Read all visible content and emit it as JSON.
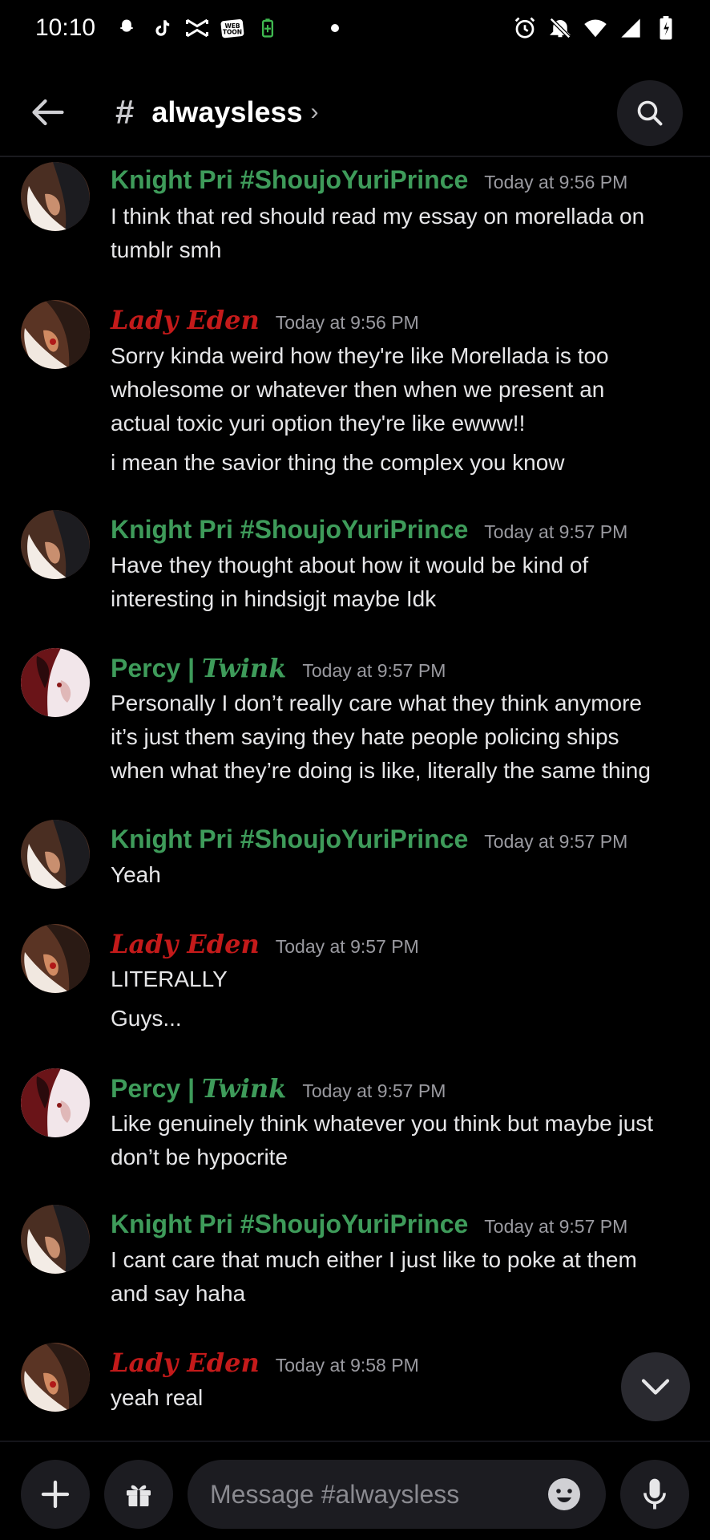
{
  "status_bar": {
    "time": "10:10"
  },
  "header": {
    "channel_prefix": "#",
    "channel_name": "alwaysless",
    "chevron": "›"
  },
  "messages": [
    {
      "author": "Knight Pri #ShoujoYuriPrince",
      "color": "#3e9b5a",
      "timestamp": "Today at 9:56 PM",
      "lines": [
        "I think that red should read my essay on morellada on",
        "tumblr smh"
      ]
    },
    {
      "author": "Lady Eden",
      "color": "#c41a1a",
      "timestamp": "Today at 9:56 PM",
      "lines": [
        "Sorry kinda weird how they're like Morellada is too",
        "wholesome or whatever then when we present an",
        "actual toxic yuri option they're like ewww!!",
        "i mean the savior thing the complex you know"
      ]
    },
    {
      "author": "Knight Pri #ShoujoYuriPrince",
      "color": "#3e9b5a",
      "timestamp": "Today at 9:57 PM",
      "lines": [
        "Have they thought about how it would be kind of",
        "interesting in hindsigjt maybe Idk"
      ]
    },
    {
      "author_a": "Percy | ",
      "author_b": "Twink",
      "color": "#3e9b5a",
      "timestamp": "Today at 9:57 PM",
      "lines": [
        "Personally I don’t really care what they think anymore",
        "it’s just them saying they hate people policing ships",
        "when what they’re doing is like, literally the same thing"
      ]
    },
    {
      "author": "Knight Pri #ShoujoYuriPrince",
      "color": "#3e9b5a",
      "timestamp": "Today at 9:57 PM",
      "lines": [
        "Yeah"
      ]
    },
    {
      "author": "Lady Eden",
      "color": "#c41a1a",
      "timestamp": "Today at 9:57 PM",
      "lines": [
        "LITERALLY",
        "Guys..."
      ]
    },
    {
      "author_a": "Percy | ",
      "author_b": "Twink",
      "color": "#3e9b5a",
      "timestamp": "Today at 9:57 PM",
      "lines": [
        "Like genuinely think whatever you think but maybe just",
        "don’t be hypocrite"
      ]
    },
    {
      "author": "Knight Pri #ShoujoYuriPrince",
      "color": "#3e9b5a",
      "timestamp": "Today at 9:57 PM",
      "lines": [
        "I cant care that much either I just like to poke at them",
        "and say haha"
      ]
    },
    {
      "author": "Lady Eden",
      "color": "#c41a1a",
      "timestamp": "Today at 9:58 PM",
      "lines": [
        "yeah real"
      ]
    }
  ],
  "composer": {
    "placeholder": "Message #alwaysless"
  }
}
